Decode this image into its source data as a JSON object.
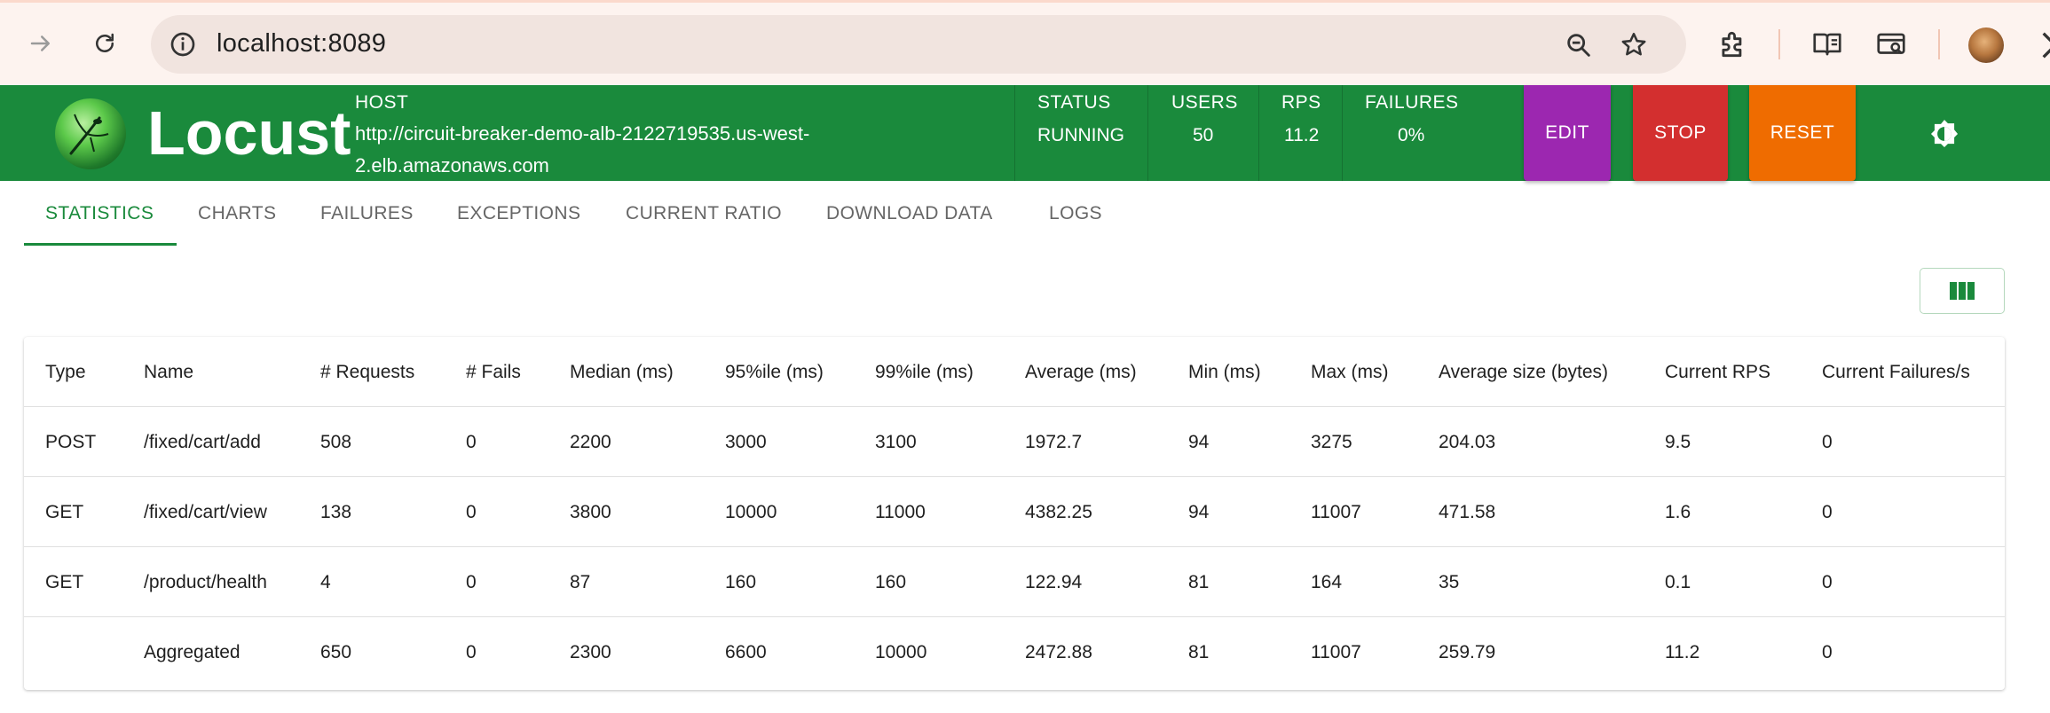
{
  "browser": {
    "url": "localhost:8089"
  },
  "app": {
    "brand": "Locust",
    "host_label": "HOST",
    "host_value": "http://circuit-breaker-demo-alb-2122719535.us-west-2.elb.amazonaws.com",
    "status_label": "STATUS",
    "status_value": "RUNNING",
    "users_label": "USERS",
    "users_value": "50",
    "rps_label": "RPS",
    "rps_value": "11.2",
    "failures_label": "FAILURES",
    "failures_value": "0%",
    "edit_label": "EDIT",
    "stop_label": "STOP",
    "reset_label": "RESET"
  },
  "tabs": [
    {
      "label": "STATISTICS",
      "active": true
    },
    {
      "label": "CHARTS"
    },
    {
      "label": "FAILURES"
    },
    {
      "label": "EXCEPTIONS"
    },
    {
      "label": "CURRENT RATIO"
    },
    {
      "label": "DOWNLOAD DATA"
    },
    {
      "label": "LOGS"
    }
  ],
  "table": {
    "headers": [
      "Type",
      "Name",
      "# Requests",
      "# Fails",
      "Median (ms)",
      "95%ile (ms)",
      "99%ile (ms)",
      "Average (ms)",
      "Min (ms)",
      "Max (ms)",
      "Average size (bytes)",
      "Current RPS",
      "Current Failures/s"
    ],
    "rows": [
      [
        "POST",
        "/fixed/cart/add",
        "508",
        "0",
        "2200",
        "3000",
        "3100",
        "1972.7",
        "94",
        "3275",
        "204.03",
        "9.5",
        "0"
      ],
      [
        "GET",
        "/fixed/cart/view",
        "138",
        "0",
        "3800",
        "10000",
        "11000",
        "4382.25",
        "94",
        "11007",
        "471.58",
        "1.6",
        "0"
      ],
      [
        "GET",
        "/product/health",
        "4",
        "0",
        "87",
        "160",
        "160",
        "122.94",
        "81",
        "164",
        "35",
        "0.1",
        "0"
      ],
      [
        "",
        "Aggregated",
        "650",
        "0",
        "2300",
        "6600",
        "10000",
        "2472.88",
        "81",
        "11007",
        "259.79",
        "11.2",
        "0"
      ]
    ]
  },
  "colors": {
    "header_green": "#1a8a3c",
    "edit": "#9c27b0",
    "stop": "#d32f2f",
    "reset": "#ef6c00"
  }
}
